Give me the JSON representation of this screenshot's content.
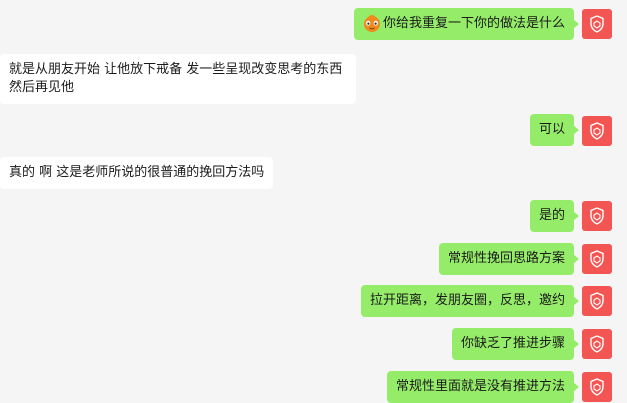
{
  "messages": [
    {
      "side": "sent",
      "text": "你给我重复一下你的做法是什么",
      "emoji": "orange-smiley-face"
    },
    {
      "side": "recv",
      "text": "就是从朋友开始 让他放下戒备 发一些呈现改变思考的东西 然后再见他"
    },
    {
      "side": "sent",
      "text": "可以"
    },
    {
      "side": "recv",
      "text": "真的 啊 这是老师所说的很普通的挽回方法吗"
    },
    {
      "side": "sent",
      "text": "是的"
    },
    {
      "side": "sent",
      "text": "常规性挽回思路方案"
    },
    {
      "side": "sent",
      "text": "拉开距离，发朋友圈，反思，邀约"
    },
    {
      "side": "sent",
      "text": "你缺乏了推进步骤"
    },
    {
      "side": "sent",
      "text": "常规性里面就是没有推进方法"
    }
  ],
  "colors": {
    "background": "#f5f5f5",
    "sent_bubble": "#95ec69",
    "recv_bubble": "#ffffff",
    "avatar": "#f25552"
  },
  "icons": {
    "avatar_icon": "shield-badge-icon"
  }
}
